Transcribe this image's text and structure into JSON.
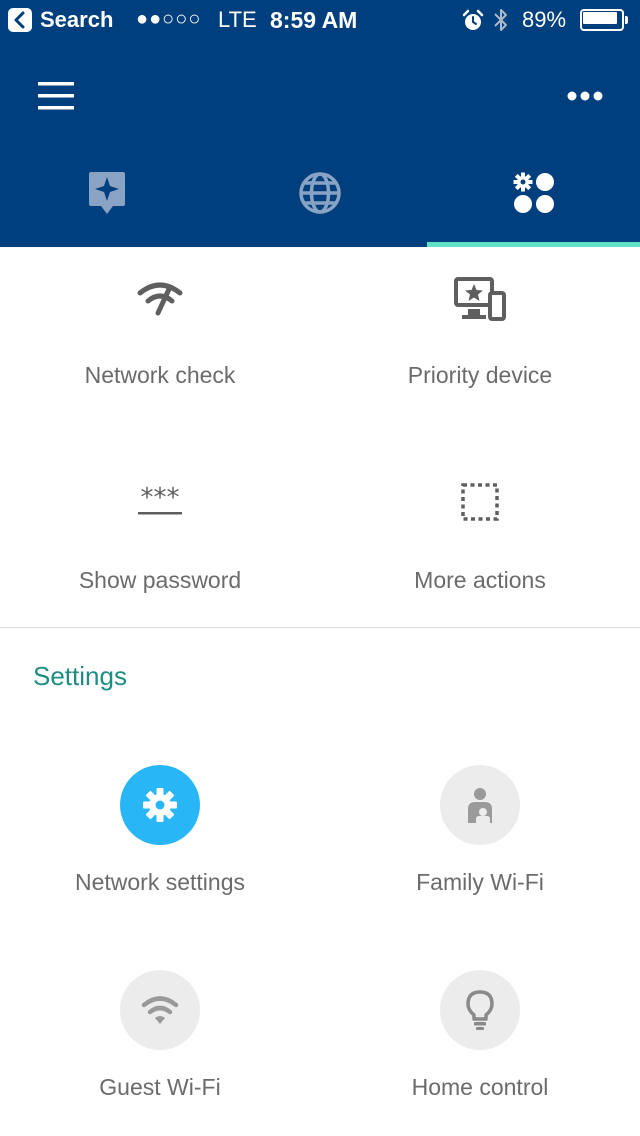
{
  "status_bar": {
    "back_label": "Search",
    "signal": "●●○○○",
    "carrier": "LTE",
    "time": "8:59 AM",
    "battery_percent": "89%",
    "battery_level": 0.89,
    "icons": [
      "back-arrow-icon",
      "alarm-icon",
      "bluetooth-icon",
      "battery-icon"
    ]
  },
  "header": {
    "background_color": "#003f7d",
    "menu_icon": "hamburger-menu-icon",
    "more_icon": "more-dots-icon"
  },
  "tabs": [
    {
      "icon": "starred-place-icon",
      "selected": false
    },
    {
      "icon": "globe-icon",
      "selected": false
    },
    {
      "icon": "settings-dots-icon",
      "selected": true
    }
  ],
  "accent_color": "#5ee0c9",
  "actions": [
    {
      "label": "Network check",
      "icon": "network-check-icon"
    },
    {
      "label": "Priority device",
      "icon": "priority-device-icon"
    },
    {
      "label": "Show password",
      "icon": "password-icon"
    },
    {
      "label": "More actions",
      "icon": "more-actions-icon"
    }
  ],
  "settings": {
    "heading": "Settings",
    "heading_color": "#1e8e82",
    "items": [
      {
        "label": "Network settings",
        "icon": "gear-icon",
        "color": "#29b6f6"
      },
      {
        "label": "Family Wi-Fi",
        "icon": "family-icon"
      },
      {
        "label": "Guest Wi-Fi",
        "icon": "wifi-icon"
      },
      {
        "label": "Home control",
        "icon": "lightbulb-icon"
      }
    ]
  }
}
